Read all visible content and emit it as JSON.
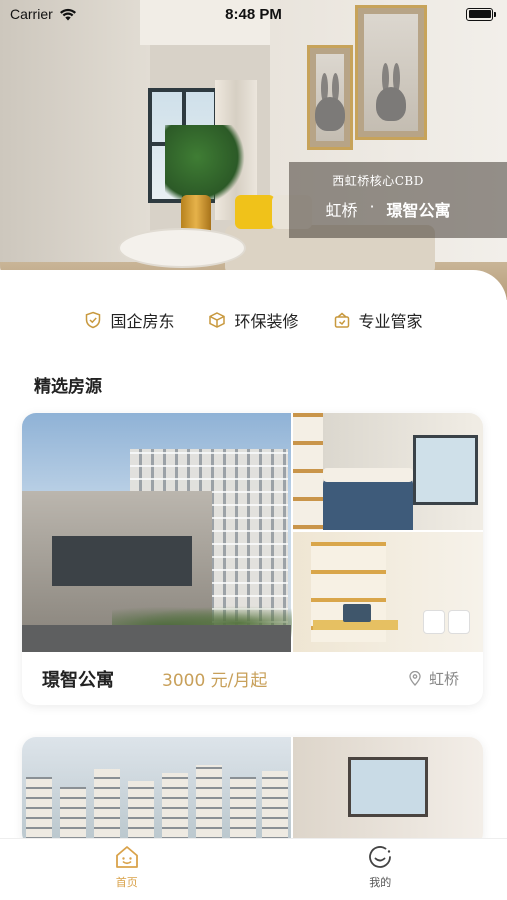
{
  "status_bar": {
    "carrier": "Carrier",
    "time": "8:48 PM"
  },
  "hero": {
    "tag": "西虹桥核心CBD",
    "district": "虹桥",
    "separator": "·",
    "apartment": "璟智公寓"
  },
  "features": [
    {
      "label": "国企房东",
      "icon": "shield-check-icon"
    },
    {
      "label": "环保装修",
      "icon": "box-icon"
    },
    {
      "label": "专业管家",
      "icon": "gift-icon"
    }
  ],
  "section_title": "精选房源",
  "listings": [
    {
      "name": "璟智公寓",
      "price": "3000 元/月起",
      "location": "虹桥"
    }
  ],
  "tabbar": {
    "items": [
      {
        "label": "首页",
        "icon": "home-icon",
        "active": true
      },
      {
        "label": "我的",
        "icon": "profile-icon",
        "active": false
      }
    ]
  },
  "colors": {
    "accent": "#d9a24a",
    "price": "#c8a05a"
  }
}
